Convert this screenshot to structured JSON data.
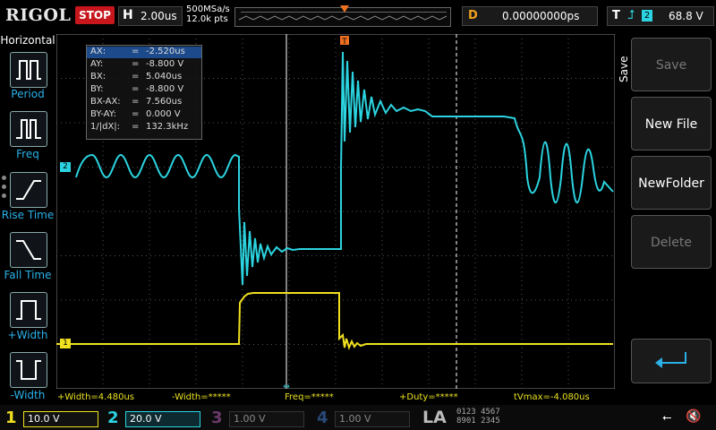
{
  "topbar": {
    "logo": "RIGOL",
    "run_status": "STOP",
    "timebase_label": "H",
    "timebase_value": "2.00us",
    "sample_rate": "500MSa/s",
    "memory_depth": "12.0k pts",
    "delay_label": "D",
    "delay_value": "0.00000000ps",
    "trigger_label": "T",
    "trigger_source": "2",
    "trigger_level": "68.8 V"
  },
  "left_menu": {
    "title": "Horizontal",
    "items": [
      {
        "label": "Period",
        "icon": "period-icon"
      },
      {
        "label": "Freq",
        "icon": "freq-icon"
      },
      {
        "label": "Rise Time",
        "icon": "rise-time-icon"
      },
      {
        "label": "Fall Time",
        "icon": "fall-time-icon"
      },
      {
        "label": "+Width",
        "icon": "pos-width-icon"
      },
      {
        "label": "-Width",
        "icon": "neg-width-icon"
      }
    ]
  },
  "cursor": {
    "rows": [
      {
        "k": "AX:",
        "e": "=",
        "v": "-2.520us"
      },
      {
        "k": "AY:",
        "e": "=",
        "v": "-8.800 V"
      },
      {
        "k": "BX:",
        "e": "=",
        "v": "5.040us"
      },
      {
        "k": "BY:",
        "e": "=",
        "v": "-8.800 V"
      },
      {
        "k": "BX-AX:",
        "e": "=",
        "v": "7.560us"
      },
      {
        "k": "BY-AY:",
        "e": "=",
        "v": "0.000 V"
      },
      {
        "k": "1/|dX|:",
        "e": "=",
        "v": "132.3kHz"
      }
    ]
  },
  "measurements": {
    "pos_width": "+Width=4.480us",
    "neg_width": "-Width=*****",
    "freq": "Freq=*****",
    "pos_duty": "+Duty=*****",
    "tvmax": "tVmax=-4.080us"
  },
  "channel_markers": {
    "ch1": "1",
    "ch2": "2"
  },
  "right_menu": {
    "title": "Save",
    "buttons": [
      {
        "label": "Save",
        "enabled": false
      },
      {
        "label": "New File",
        "enabled": true
      },
      {
        "label": "NewFolder",
        "enabled": true
      },
      {
        "label": "Delete",
        "enabled": false
      }
    ],
    "return_icon": "return-arrow-icon"
  },
  "channels": [
    {
      "num": "1",
      "value": "10.0 V",
      "color": "#f0e020",
      "active": true
    },
    {
      "num": "2",
      "value": "20.0 V",
      "color": "#2bd4e0",
      "active": true
    },
    {
      "num": "3",
      "value": "1.00 V",
      "color": "#c040c0",
      "active": false
    },
    {
      "num": "4",
      "value": "1.00 V",
      "color": "#3070e0",
      "active": false
    }
  ],
  "la": {
    "label": "LA",
    "digits_row1": "0123 4567",
    "digits_row2": "8901 2345"
  },
  "status_icons": {
    "usb": "usb-icon",
    "mute": "speaker-mute-icon"
  },
  "colors": {
    "ch1": "#f0e020",
    "ch2": "#2bd4e0",
    "stop": "#c8161d",
    "delay": "#f0a020"
  }
}
